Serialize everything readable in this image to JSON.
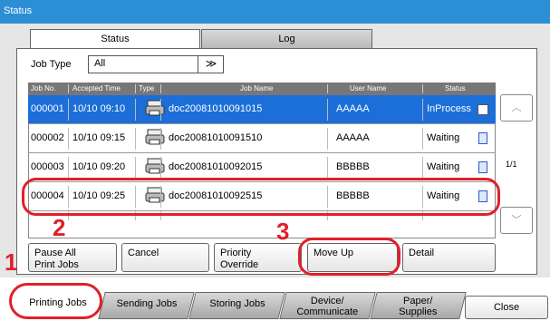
{
  "window": {
    "title": "Status"
  },
  "tabs": [
    {
      "label": "Status"
    },
    {
      "label": "Log"
    }
  ],
  "filter": {
    "label": "Job Type",
    "value": "All"
  },
  "table": {
    "headers": [
      "Job No.",
      "Accepted Time",
      "Type",
      "Job Name",
      "User Name",
      "Status"
    ],
    "rows": [
      {
        "job_no": "000001",
        "time": "10/10 09:10",
        "name": "doc20081010091015",
        "user": "AAAAA",
        "status": "InProcess"
      },
      {
        "job_no": "000002",
        "time": "10/10 09:15",
        "name": "doc20081010091510",
        "user": "AAAAA",
        "status": "Waiting"
      },
      {
        "job_no": "000003",
        "time": "10/10 09:20",
        "name": "doc20081010092015",
        "user": "BBBBB",
        "status": "Waiting"
      },
      {
        "job_no": "000004",
        "time": "10/10 09:25",
        "name": "doc20081010092515",
        "user": "BBBBB",
        "status": "Waiting"
      }
    ]
  },
  "pager": {
    "text": "1/1"
  },
  "actions": {
    "pause_all": "Pause All\nPrint Jobs",
    "cancel": "Cancel",
    "priority_override": "Priority\nOverride",
    "move_up": "Move Up",
    "detail": "Detail"
  },
  "callouts": [
    "1",
    "2",
    "3"
  ],
  "bottom_tabs": [
    {
      "label": "Printing Jobs"
    },
    {
      "label": "Sending Jobs"
    },
    {
      "label": "Storing Jobs"
    },
    {
      "label": "Device/\nCommunicate"
    },
    {
      "label": "Paper/\nSupplies"
    }
  ],
  "close": "Close",
  "colors": {
    "title_bar": "#2b8fd6",
    "selected_row": "#1c6fd8",
    "callout": "#e0202a"
  }
}
